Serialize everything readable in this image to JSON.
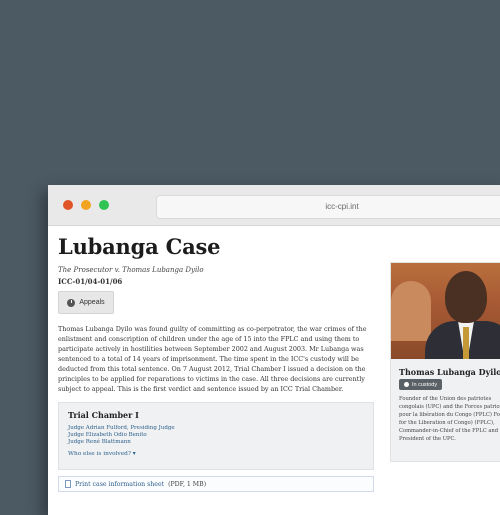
{
  "browser": {
    "url": "icc-cpi.int",
    "traffic_lights": [
      "#e05427",
      "#f2a31f",
      "#31c353"
    ]
  },
  "page": {
    "title": "Lubanga Case",
    "subtitle": "The Prosecutor v. Thomas Lubanga Dyilo",
    "case_number": "ICC-01/04-01/06",
    "appeals_button": "Appeals",
    "summary": "Thomas Lubanga Dyilo was found guilty of committing as co-perpetrator, the war crimes of the enlistment and conscription of children under the age of 15 into the FPLC and using them to participate actively in hostilities between September 2002 and August 2003. Mr Lubanga was sentenced to a total of 14 years of imprisonment. The time spent in the ICC's custody will be deducted from this total sentence. On 7 August 2012, Trial Chamber I issued a decision on the principles to be applied for reparations to victims in the case. All three decisions are currently subject to appeal. This is the first verdict and sentence issued by an ICC Trial Chamber."
  },
  "chamber": {
    "title": "Trial Chamber I",
    "judges": [
      "Judge Adrian Fulford, Presiding Judge",
      "Judge Elizabeth Odio Benito",
      "Judge René Blattmann"
    ],
    "involved_link": "Who else is involved?  ▾"
  },
  "print": {
    "label": "Print case information sheet",
    "size": "(PDF, 1 MB)"
  },
  "profile": {
    "name": "Thomas Lubanga Dyilo",
    "status": "In custody",
    "description": "Founder of the Union des patriotes congolais (UPC) and the Forces patriotiques pour la libération du Congo (FPLC) Force for the Liberation of Congo) (FPLC), Commander-in-Chief of the FPLC and President of the UPC."
  }
}
